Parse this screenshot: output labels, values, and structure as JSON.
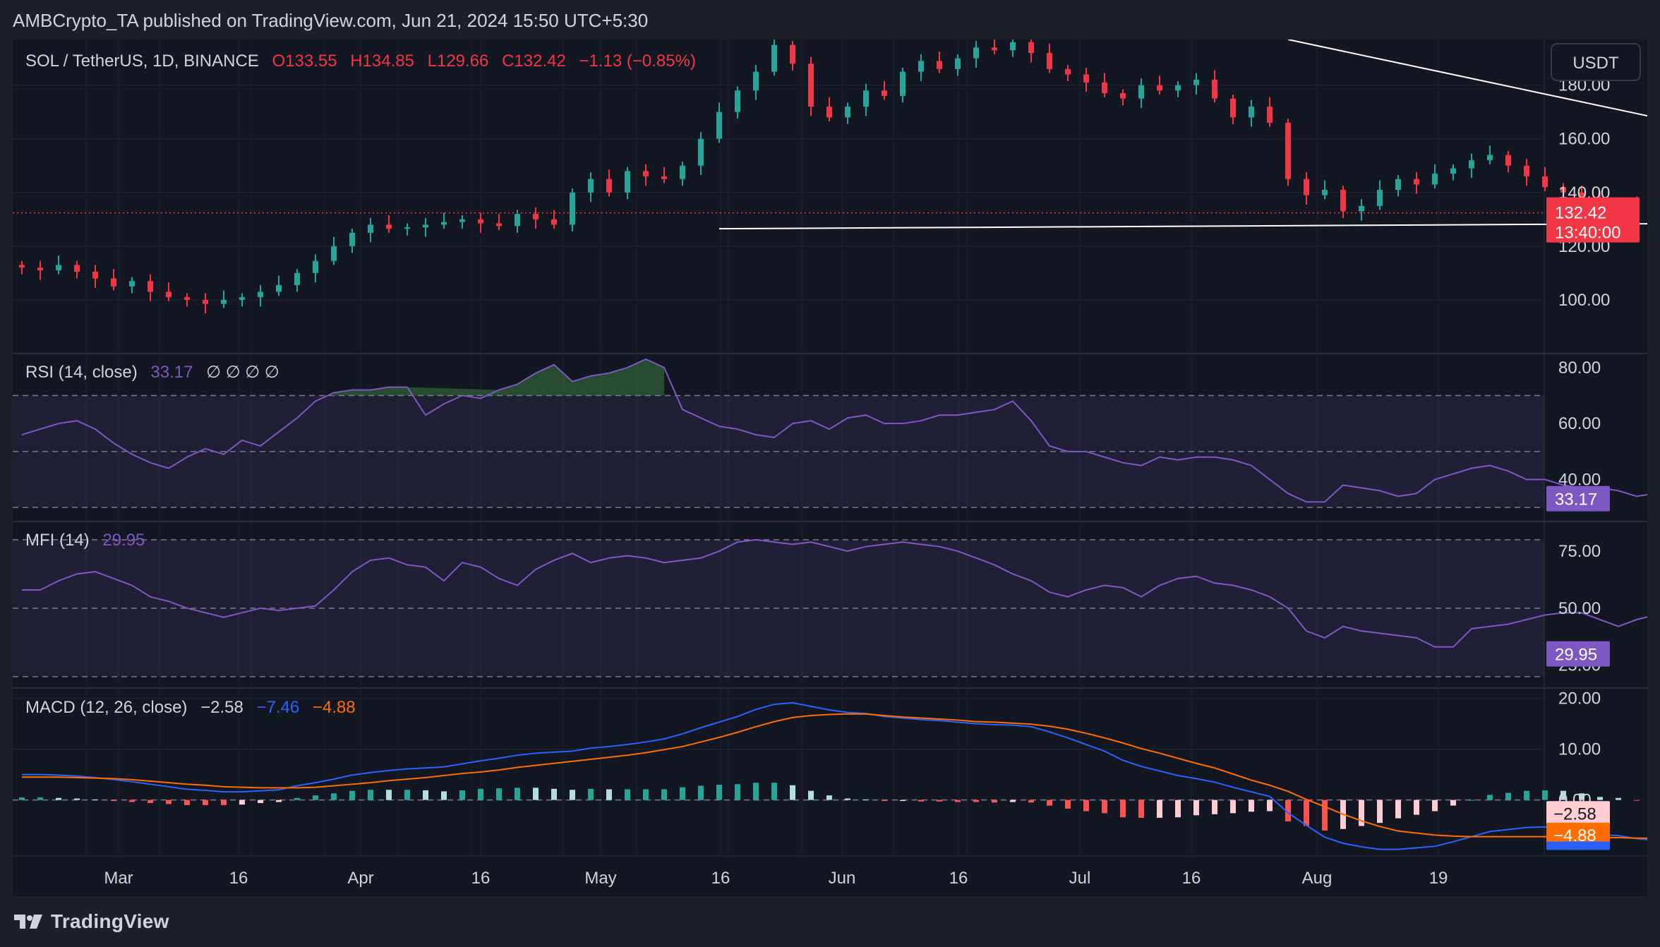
{
  "header": {
    "publisher": "AMBCrypto_TA published on TradingView.com, Jun 21, 2024 15:50 UTC+5:30"
  },
  "footer": {
    "brand": "TradingView"
  },
  "currency_button": "USDT",
  "colors": {
    "up": "#26a69a",
    "down": "#f23645",
    "rsi": "#7e57c2",
    "macd": "#2962ff",
    "signal": "#ff6d00",
    "trendline": "#ffffff"
  },
  "chart_data": [
    {
      "type": "candlestick",
      "legend": {
        "symbol": "SOL / TetherUS, 1D, BINANCE",
        "open": "O133.55",
        "high": "H134.85",
        "low": "L129.66",
        "close": "C132.42",
        "change": "−1.13 (−0.85%)"
      },
      "y_ticks": [
        "180.00",
        "160.00",
        "140.00",
        "120.00",
        "100.00"
      ],
      "ylim": [
        80,
        197
      ],
      "last_price": "132.42",
      "countdown": "13:40:00",
      "x_ticks": [
        "Mar",
        "16",
        "Apr",
        "16",
        "May",
        "16",
        "Jun",
        "16",
        "Jul",
        "16",
        "Aug",
        "19"
      ],
      "close": [
        112.0,
        111.0,
        113.0,
        110.5,
        108.0,
        105.0,
        107.0,
        103.0,
        101.0,
        100.0,
        98.5,
        100.0,
        101.0,
        103.0,
        105.5,
        110.0,
        114.5,
        120.0,
        125.0,
        128.0,
        126.5,
        127.0,
        128.0,
        129.0,
        130.0,
        128.5,
        127.5,
        132.0,
        130.0,
        128.0,
        140.0,
        145.0,
        140.0,
        148.0,
        146.0,
        145.0,
        150.0,
        160.0,
        170.0,
        178.0,
        185.0,
        195.0,
        188.0,
        172.0,
        168.0,
        172.0,
        178.0,
        176.0,
        185.0,
        189.0,
        186.0,
        190.0,
        194.0,
        193.0,
        196.0,
        192.0,
        186.0,
        184.0,
        181.0,
        177.0,
        175.0,
        180.0,
        178.0,
        180.0,
        182.0,
        175.0,
        168.0,
        172.0,
        166.0,
        145.0,
        139.0,
        141.0,
        133.0,
        135.0,
        141.0,
        145.0,
        143.0,
        147.0,
        149.0,
        152.0,
        154.0,
        150.0,
        146.0,
        142.0,
        140.0,
        137.0,
        135.0,
        136.0,
        134.0,
        133.0,
        131.0,
        130.0,
        137.0,
        140.0,
        142.0,
        144.0,
        146.0,
        150.0,
        156.0,
        152.0,
        148.0,
        145.0,
        146.0,
        150.0,
        152.0,
        147.0,
        146.0,
        145.0,
        145.0,
        144.0,
        142.0,
        145.0,
        155.0,
        162.0,
        170.0,
        175.0,
        172.0,
        178.0,
        187.0,
        185.0,
        176.0,
        171.0,
        166.0,
        165.0,
        164.0,
        167.0,
        170.0,
        171.0,
        168.0,
        170.0,
        166.0,
        167.0,
        166.0,
        164.0,
        163.0,
        166.0,
        165.0,
        171.0,
        173.0,
        171.0,
        167.0,
        161.0,
        159.0,
        161.0,
        154.0,
        148.0,
        150.0,
        154.0,
        147.0,
        145.0,
        142.0,
        146.0,
        152.0,
        149.0,
        141.0,
        136.0,
        135.0,
        133.55,
        132.42
      ],
      "trendlines": [
        {
          "name": "descending resistance",
          "from": [
            69.5,
            197.0
          ],
          "to": [
            116.0,
            129.5
          ]
        },
        {
          "name": "horizontal support",
          "from": [
            38.5,
            126.5
          ],
          "to": [
            120.5,
            129.5
          ]
        }
      ]
    },
    {
      "type": "line",
      "legend": {
        "label": "RSI (14, close)",
        "value": "33.17",
        "extra": "∅ ∅ ∅ ∅"
      },
      "y_ticks": [
        "80.00",
        "60.00",
        "40.00"
      ],
      "bands": [
        70,
        50,
        30
      ],
      "ylim": [
        25,
        85
      ],
      "last_value": "33.17",
      "values": [
        56,
        58,
        60,
        61,
        58,
        53,
        49,
        46,
        44,
        48,
        51,
        49,
        54,
        52,
        57,
        62,
        68,
        71,
        72,
        72,
        73,
        73,
        63,
        67,
        70,
        69,
        72,
        74,
        78,
        81,
        75,
        77,
        78,
        80,
        83,
        80,
        65,
        62,
        59,
        58,
        56,
        55,
        60,
        61,
        58,
        62,
        63,
        60,
        60,
        61,
        63,
        63,
        64,
        65,
        68,
        61,
        52,
        50,
        50,
        48,
        46,
        45,
        48,
        47,
        48,
        48,
        47,
        45,
        40,
        35,
        32,
        32,
        38,
        37,
        36,
        34,
        35,
        40,
        42,
        44,
        45,
        43,
        40,
        40,
        38,
        37,
        37,
        36,
        34,
        35,
        39,
        40,
        42,
        44,
        46,
        46,
        45,
        48,
        48,
        45,
        43,
        46,
        48,
        45,
        43,
        46,
        45,
        46,
        45,
        48,
        55,
        61,
        63,
        60,
        65,
        70,
        65,
        63,
        61,
        60,
        53,
        50,
        50,
        52,
        51,
        52,
        51,
        51,
        50,
        50,
        51,
        48,
        50,
        55,
        55,
        53,
        47,
        45,
        44,
        46,
        44,
        40,
        37,
        40,
        42,
        42,
        40,
        37,
        38,
        42,
        40,
        37,
        36,
        35,
        35,
        34,
        33.17
      ],
      "overbought_fill": true
    },
    {
      "type": "line",
      "legend": {
        "label": "MFI (14)",
        "value": "29.95"
      },
      "y_ticks": [
        "75.00",
        "50.00",
        "25.00"
      ],
      "bands": [
        80,
        50,
        20
      ],
      "ylim": [
        15,
        88
      ],
      "last_value": "29.95",
      "values": [
        58,
        58,
        62,
        65,
        66,
        63,
        60,
        55,
        53,
        50,
        48,
        46,
        48,
        50,
        49,
        50,
        51,
        58,
        66,
        71,
        72,
        69,
        68,
        62,
        70,
        68,
        63,
        60,
        67,
        71,
        74,
        70,
        72,
        73,
        72,
        70,
        71,
        72,
        75,
        79,
        80,
        79,
        78,
        79,
        77,
        75,
        77,
        78,
        79,
        78,
        77,
        75,
        72,
        69,
        65,
        62,
        57,
        55,
        58,
        60,
        59,
        55,
        60,
        63,
        64,
        61,
        60,
        58,
        55,
        50,
        40,
        37,
        42,
        40,
        39,
        38,
        37,
        33,
        33,
        41,
        42,
        43,
        45,
        47,
        48,
        48,
        45,
        42,
        45,
        47,
        45,
        47,
        49,
        52,
        59,
        64,
        61,
        56,
        53,
        52,
        48,
        47,
        49,
        50,
        53,
        49,
        47,
        52,
        55,
        54,
        55,
        56,
        57,
        58,
        61,
        60,
        59,
        59,
        58,
        59,
        58,
        58,
        58,
        56,
        53,
        50,
        49,
        48,
        48,
        48,
        50,
        45,
        41,
        38,
        35,
        38,
        41,
        35,
        30,
        35,
        42,
        47,
        50,
        52,
        47,
        45,
        42,
        38,
        33,
        35,
        37,
        40,
        33,
        28,
        29,
        29.95
      ]
    },
    {
      "type": "line",
      "legend": {
        "label": "MACD (12, 26, close)",
        "histogram": "−2.58",
        "macd": "−7.46",
        "signal": "−4.88"
      },
      "y_ticks": [
        "20.00",
        "10.00",
        "0.00"
      ],
      "ylim": [
        -11,
        22
      ],
      "last_values": {
        "histogram": "−2.58",
        "signal": "−4.88",
        "macd": "−7.46"
      },
      "macd": [
        5.0,
        5.0,
        4.9,
        4.7,
        4.4,
        4.0,
        3.6,
        3.1,
        2.6,
        2.1,
        1.9,
        1.6,
        1.6,
        1.8,
        2.0,
        2.8,
        3.4,
        4.1,
        4.9,
        5.4,
        5.8,
        6.1,
        6.3,
        6.5,
        7.1,
        7.7,
        8.2,
        8.8,
        9.2,
        9.4,
        9.6,
        10.2,
        10.5,
        10.9,
        11.4,
        12.0,
        13.0,
        14.2,
        15.3,
        16.4,
        17.8,
        18.8,
        19.1,
        18.4,
        17.7,
        17.2,
        17.0,
        16.4,
        16.1,
        15.8,
        15.6,
        15.3,
        15.0,
        14.8,
        14.7,
        14.4,
        13.4,
        12.2,
        10.9,
        9.6,
        7.8,
        6.6,
        5.7,
        4.8,
        4.2,
        3.5,
        2.5,
        1.6,
        0.7,
        -2.5,
        -5.0,
        -7.3,
        -8.5,
        -9.2,
        -9.7,
        -9.7,
        -9.4,
        -9.1,
        -8.2,
        -7.2,
        -6.2,
        -5.8,
        -5.4,
        -5.3,
        -5.5,
        -6.0,
        -6.8,
        -7.0,
        -7.6,
        -7.9,
        -7.7,
        -7.4,
        -6.4,
        -5.4,
        -4.5,
        -3.9,
        -3.3,
        -2.8,
        -2.1,
        -1.7,
        -1.4,
        -1.3,
        -1.1,
        -0.8,
        -0.9,
        -0.8,
        -0.6,
        -0.7,
        -0.6,
        -0.5,
        -0.3,
        0.1,
        1.0,
        2.3,
        3.8,
        5.1,
        5.8,
        6.7,
        7.3,
        7.6,
        7.7,
        7.3,
        6.6,
        5.9,
        5.6,
        5.1,
        4.6,
        4.2,
        3.9,
        3.6,
        3.3,
        2.9,
        2.6,
        2.4,
        2.0,
        1.8,
        1.5,
        1.6,
        1.6,
        1.5,
        1.1,
        0.3,
        -0.4,
        -1.0,
        -1.6,
        -2.5,
        -2.9,
        -3.4,
        -3.9,
        -4.2,
        -4.4,
        -4.6,
        -4.3,
        -4.6,
        -5.4,
        -6.2,
        -6.8,
        -7.46
      ],
      "signal": [
        4.5,
        4.5,
        4.5,
        4.4,
        4.3,
        4.2,
        4.0,
        3.7,
        3.4,
        3.1,
        2.9,
        2.6,
        2.5,
        2.4,
        2.4,
        2.4,
        2.5,
        2.8,
        3.1,
        3.4,
        3.8,
        4.1,
        4.4,
        4.8,
        5.2,
        5.5,
        5.9,
        6.4,
        6.8,
        7.2,
        7.6,
        8.0,
        8.4,
        8.8,
        9.3,
        9.9,
        10.5,
        11.4,
        12.3,
        13.3,
        14.4,
        15.4,
        16.2,
        16.6,
        16.8,
        16.9,
        16.9,
        16.6,
        16.3,
        16.1,
        15.9,
        15.7,
        15.4,
        15.3,
        15.1,
        14.9,
        14.5,
        13.9,
        13.1,
        12.2,
        11.2,
        10.1,
        9.2,
        8.2,
        7.2,
        6.3,
        5.1,
        3.9,
        2.9,
        1.7,
        0.1,
        -1.3,
        -2.8,
        -4.1,
        -5.2,
        -6.1,
        -6.5,
        -6.9,
        -7.1,
        -7.2,
        -7.2,
        -7.2,
        -7.2,
        -7.2,
        -7.3,
        -7.3,
        -7.4,
        -7.4,
        -7.5,
        -7.5,
        -7.5,
        -7.5,
        -7.4,
        -7.2,
        -7.0,
        -6.6,
        -6.2,
        -5.7,
        -5.1,
        -4.6,
        -4.1,
        -3.6,
        -3.2,
        -2.8,
        -2.6,
        -2.4,
        -2.2,
        -1.9,
        -1.7,
        -1.4,
        -1.2,
        -0.9,
        -0.5,
        0.0,
        0.7,
        1.4,
        2.1,
        2.9,
        3.6,
        4.3,
        4.9,
        5.4,
        5.6,
        5.6,
        5.6,
        5.5,
        5.4,
        5.2,
        5.0,
        4.8,
        4.6,
        4.5,
        4.3,
        4.1,
        3.9,
        3.7,
        3.5,
        3.3,
        3.0,
        2.8,
        2.5,
        2.2,
        1.8,
        1.3,
        0.7,
        0.3,
        -0.2,
        -0.7,
        -1.2,
        -1.7,
        -2.2,
        -2.7,
        -3.2,
        -3.8,
        -4.3,
        -4.88
      ]
    }
  ]
}
